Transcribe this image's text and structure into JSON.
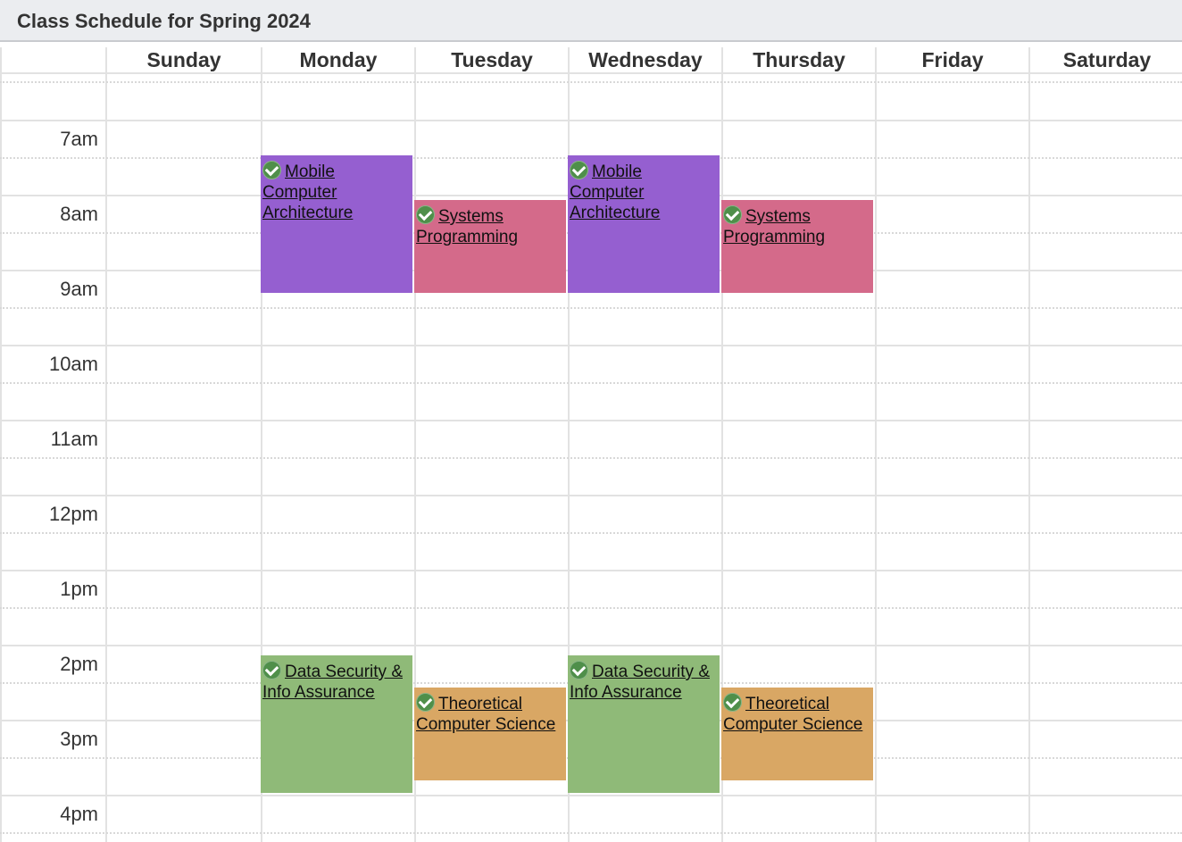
{
  "window": {
    "title": "Class Schedule for Spring 2024"
  },
  "days": [
    "Sunday",
    "Monday",
    "Tuesday",
    "Wednesday",
    "Thursday",
    "Friday",
    "Saturday"
  ],
  "times": [
    "7am",
    "8am",
    "9am",
    "10am",
    "11am",
    "12pm",
    "1pm",
    "2pm",
    "3pm",
    "4pm"
  ],
  "events": [
    {
      "title": "Mobile Computer Architecture",
      "day": "Monday",
      "color": "#955fd0"
    },
    {
      "title": "Systems Programming",
      "day": "Tuesday",
      "color": "#d46a8a"
    },
    {
      "title": "Mobile Computer Architecture",
      "day": "Wednesday",
      "color": "#955fd0"
    },
    {
      "title": "Systems Programming",
      "day": "Thursday",
      "color": "#d46a8a"
    },
    {
      "title": "Data Security & Info Assurance",
      "day": "Monday",
      "color": "#8fba78"
    },
    {
      "title": "Theoretical Computer Science",
      "day": "Tuesday",
      "color": "#d9a764"
    },
    {
      "title": "Data Security & Info Assurance",
      "day": "Wednesday",
      "color": "#8fba78"
    },
    {
      "title": "Theoretical Computer Science",
      "day": "Thursday",
      "color": "#d9a764"
    }
  ],
  "icons": {
    "registered": "checkmark-circle-icon"
  }
}
